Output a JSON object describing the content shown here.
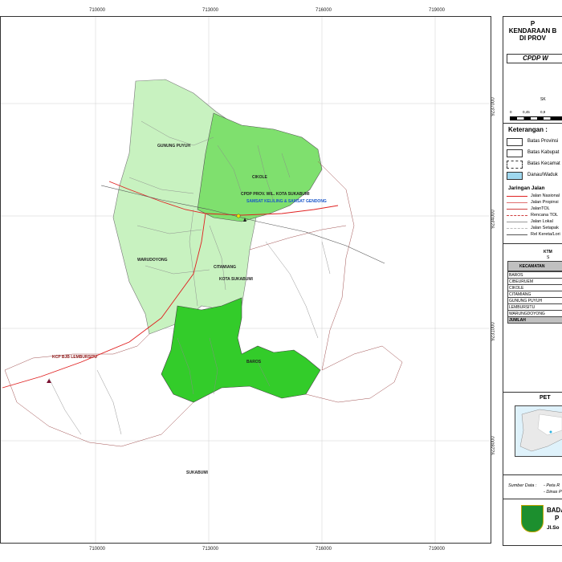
{
  "map": {
    "x_ticks": [
      "710000",
      "713000",
      "716000",
      "719000"
    ],
    "y_ticks": [
      "9237000",
      "9234000",
      "9231000",
      "9228000"
    ],
    "labels": {
      "gunung_puyuh": "GUNUNG PUYUH",
      "cikole": "CIKOLE",
      "warudoyong": "WARUDOYONG",
      "citamiang": "CITAMIANG",
      "kota_sukabumi": "KOTA SUKABUMI",
      "baros": "BAROS",
      "sukabumi": "SUKABUMI",
      "cpdp": "CPDP PROV. WIL. KOTA SUKABUMI",
      "samsat_keliling": "SAMSAT KELILING & SAMSAT GENDONG",
      "kcp": "KCP BJB LEMBURSITU"
    },
    "colors": {
      "light_green": "#c8f2c0",
      "medium_green": "#7fe06e",
      "bright_green": "#33cc2a",
      "road_nasional": "#e02020",
      "rel": "#555555",
      "kabupaten_line": "#a05050"
    }
  },
  "panel": {
    "title_lines": [
      "P",
      "KENDARAAN B",
      "DI PROV"
    ],
    "subtitle": "CPDP W",
    "scale_label": "SK",
    "scale_ticks": [
      "0",
      "0,45",
      "0,9"
    ],
    "keterangan": "Keterangan :",
    "legend": [
      {
        "label": "Batas Provinsi",
        "fill": "#ffffff"
      },
      {
        "label": "Batas Kabupat",
        "fill": "#ffffff"
      },
      {
        "label": "Batas Kecamat",
        "fill": "#ffffff"
      },
      {
        "label": "Danau/Waduk",
        "fill": "#9fd8ef"
      }
    ],
    "jaringan_title": "Jaringan Jalan",
    "roads": [
      {
        "label": "Jalan Nasional",
        "color": "#e02020",
        "style": "solid"
      },
      {
        "label": "Jalan Propinsi",
        "color": "#e07070",
        "style": "solid"
      },
      {
        "label": "JalanTOL",
        "color": "#d04040",
        "style": "solid"
      },
      {
        "label": "Rencana TOL",
        "color": "#d04040",
        "style": "dashed"
      },
      {
        "label": "Jalan Lokal",
        "color": "#999999",
        "style": "solid"
      },
      {
        "label": "Jalan Setapak",
        "color": "#bbbbbb",
        "style": "dashed"
      },
      {
        "label": "Rel Kereta/Lori",
        "color": "#555555",
        "style": "solid"
      }
    ],
    "table_title": "KTM",
    "table_sub": "S",
    "table_header": "KECAMATAN",
    "kecamatan": [
      "BAROS",
      "CIBEURUEM",
      "CIKOLE",
      "CITAMIANG",
      "GUNUNG PUYUH",
      "LEMBURSITU",
      "WARUNGDOYONG"
    ],
    "total_label": "JUMLAH",
    "peta_title": "PET",
    "sumber_label": "Sumber Data :",
    "sumber_lines": [
      "- Peta R",
      "- Dinas P"
    ],
    "org_name": "BADA",
    "org_line2": "P",
    "org_addr": "Jl.So"
  }
}
